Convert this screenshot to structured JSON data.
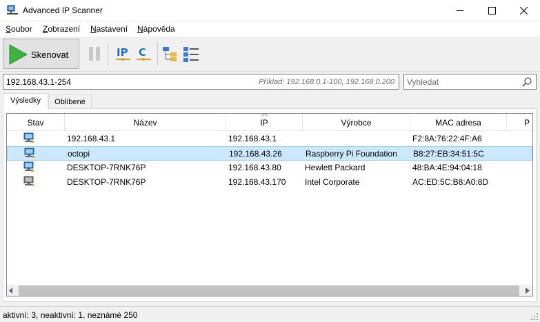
{
  "window": {
    "title": "Advanced IP Scanner",
    "accent": "#0078d7"
  },
  "menu": [
    {
      "key": "S",
      "rest": "oubor"
    },
    {
      "key": "Z",
      "rest": "obrazení"
    },
    {
      "key": "N",
      "rest": "astavení"
    },
    {
      "key": "N",
      "rest": "ápověda"
    }
  ],
  "toolbar": {
    "scan_label": "Skenovat",
    "ip_label": "IP",
    "c_label": "C",
    "icons": [
      "play-icon",
      "pause-icon",
      "ip-icon",
      "c-icon",
      "expand-tree-icon",
      "collapse-list-icon"
    ]
  },
  "address": {
    "value": "192.168.43.1-254",
    "hint": "Příklad: 192.168.0.1-100, 192.168.0.200"
  },
  "search": {
    "placeholder": "Vyhledat"
  },
  "tabs": [
    "Výsledky",
    "Oblíbené"
  ],
  "columns": [
    "Stav",
    "Název",
    "IP",
    "Výrobce",
    "MAC adresa",
    "P"
  ],
  "rows": [
    {
      "status": "online",
      "name": "192.168.43.1",
      "ip": "192.168.43.1",
      "vendor": "",
      "mac": "F2:8A:76:22:4F:A6",
      "selected": false
    },
    {
      "status": "online",
      "name": "octopi",
      "ip": "192.168.43.26",
      "vendor": "Raspberry Pi Foundation",
      "mac": "B8:27:EB:34:51:5C",
      "selected": true
    },
    {
      "status": "online",
      "name": "DESKTOP-7RNK76P",
      "ip": "192.168.43.80",
      "vendor": "Hewlett Packard",
      "mac": "48:BA:4E:94:04:18",
      "selected": false
    },
    {
      "status": "offline",
      "name": "DESKTOP-7RNK76P",
      "ip": "192.168.43.170",
      "vendor": "Intel Corporate",
      "mac": "AC:ED:5C:B8:A0:8D",
      "selected": false
    }
  ],
  "status_bar": {
    "text": "aktivní: 3, neaktivní: 1, neznámé 250"
  },
  "colors": {
    "online": "#1e88e5",
    "offline": "#7a7a7a",
    "selection": "#cce8ff",
    "play": "#3cb43c"
  }
}
